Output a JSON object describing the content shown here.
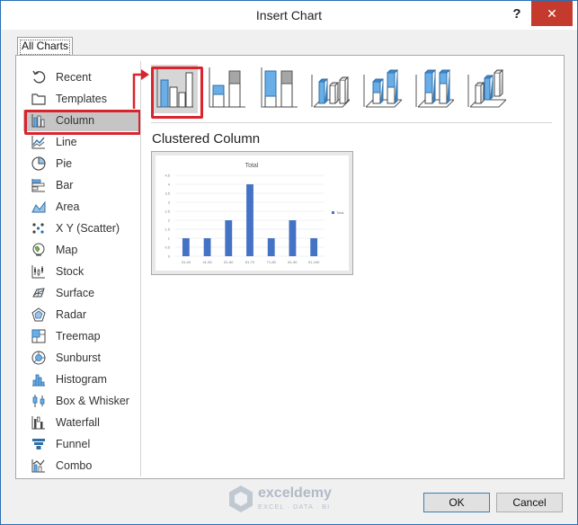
{
  "dialog": {
    "title": "Insert Chart",
    "help_label": "?",
    "close_label": "✕"
  },
  "tabs": [
    {
      "label": "All Charts",
      "selected": true
    }
  ],
  "chart_types": [
    {
      "label": "Recent",
      "icon": "recent-icon"
    },
    {
      "label": "Templates",
      "icon": "templates-folder-icon"
    },
    {
      "label": "Column",
      "icon": "column-chart-icon",
      "selected": true
    },
    {
      "label": "Line",
      "icon": "line-chart-icon"
    },
    {
      "label": "Pie",
      "icon": "pie-chart-icon"
    },
    {
      "label": "Bar",
      "icon": "bar-chart-icon"
    },
    {
      "label": "Area",
      "icon": "area-chart-icon"
    },
    {
      "label": "X Y (Scatter)",
      "icon": "scatter-chart-icon"
    },
    {
      "label": "Map",
      "icon": "map-chart-icon"
    },
    {
      "label": "Stock",
      "icon": "stock-chart-icon"
    },
    {
      "label": "Surface",
      "icon": "surface-chart-icon"
    },
    {
      "label": "Radar",
      "icon": "radar-chart-icon"
    },
    {
      "label": "Treemap",
      "icon": "treemap-chart-icon"
    },
    {
      "label": "Sunburst",
      "icon": "sunburst-chart-icon"
    },
    {
      "label": "Histogram",
      "icon": "histogram-chart-icon"
    },
    {
      "label": "Box & Whisker",
      "icon": "box-whisker-chart-icon"
    },
    {
      "label": "Waterfall",
      "icon": "waterfall-chart-icon"
    },
    {
      "label": "Funnel",
      "icon": "funnel-chart-icon"
    },
    {
      "label": "Combo",
      "icon": "combo-chart-icon"
    }
  ],
  "subtypes": [
    {
      "icon": "clustered-column-icon",
      "selected": true
    },
    {
      "icon": "stacked-column-icon"
    },
    {
      "icon": "100-stacked-column-icon"
    },
    {
      "icon": "3d-clustered-column-icon"
    },
    {
      "icon": "3d-stacked-column-icon"
    },
    {
      "icon": "3d-100-stacked-column-icon"
    },
    {
      "icon": "3d-column-icon"
    }
  ],
  "selected_subtype_name": "Clustered Column",
  "buttons": {
    "ok": "OK",
    "cancel": "Cancel"
  },
  "watermark": {
    "name": "exceldemy",
    "tagline": "EXCEL · DATA · BI"
  },
  "colors": {
    "accent_blue": "#4472c4",
    "highlight_red": "#d9232e",
    "selection_gray": "#c5c5c5"
  },
  "chart_data": {
    "type": "bar",
    "title": "Total",
    "categories": [
      "31-40",
      "41-50",
      "51-60",
      "61-70",
      "71-80",
      "81-90",
      "91-100"
    ],
    "series": [
      {
        "name": "Total",
        "values": [
          1,
          1,
          2,
          4,
          1,
          2,
          1
        ]
      }
    ],
    "yticks": [
      "0",
      "0.5",
      "1",
      "1.5",
      "2",
      "2.5",
      "3",
      "3.5",
      "4",
      "4.5"
    ],
    "ylim": [
      0,
      4.5
    ],
    "grid": true,
    "legend": "right"
  }
}
